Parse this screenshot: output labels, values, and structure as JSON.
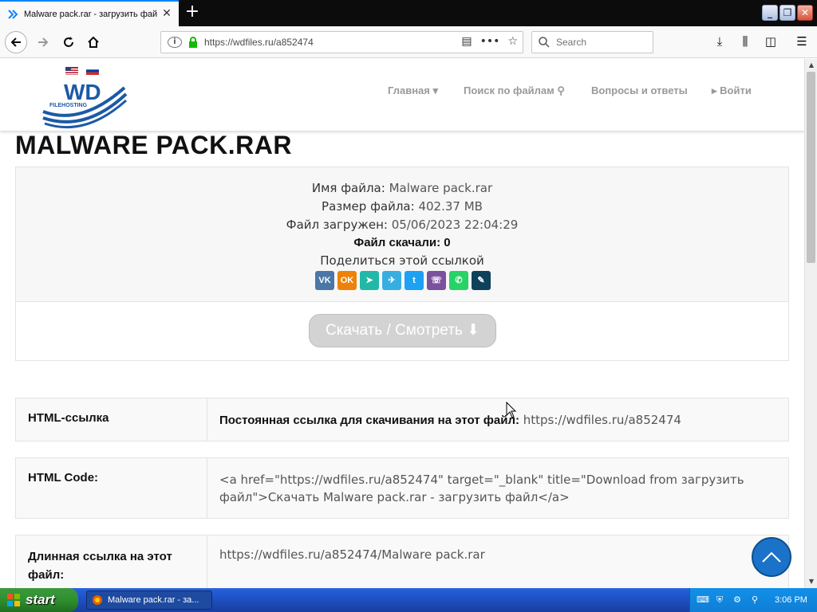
{
  "browser": {
    "tab_title": "Malware pack.rar - загрузить фай",
    "url": "https://wdfiles.ru/a852474",
    "search_placeholder": "Search"
  },
  "site": {
    "logo_text": "WD",
    "logo_sub": "FILEHOSTING",
    "nav": {
      "home": "Главная",
      "search": "Поиск по файлам",
      "faq": "Вопросы и ответы",
      "login": "Войти"
    }
  },
  "page": {
    "title": "MALWARE PACK.RAR",
    "file_name_label": "Имя файла:",
    "file_name": "Malware pack.rar",
    "file_size_label": "Размер файла:",
    "file_size": "402.37 MB",
    "uploaded_label": "Файл загружен:",
    "uploaded": "05/06/2023 22:04:29",
    "downloads": "Файл скачали: 0",
    "share_text": "Поделиться этой ссылкой",
    "download_button": "Скачать / Смотреть"
  },
  "share_icons": [
    {
      "name": "vk-icon",
      "glyph": "VK",
      "color": "#4a76a8"
    },
    {
      "name": "odnoklassniki-icon",
      "glyph": "OK",
      "color": "#ee8208"
    },
    {
      "name": "send-icon",
      "glyph": "➤",
      "color": "#22b8a7"
    },
    {
      "name": "telegram-icon",
      "glyph": "✈",
      "color": "#37aee2"
    },
    {
      "name": "twitter-icon",
      "glyph": "t",
      "color": "#1da1f2"
    },
    {
      "name": "viber-icon",
      "glyph": "☏",
      "color": "#7b519d"
    },
    {
      "name": "whatsapp-icon",
      "glyph": "✆",
      "color": "#25d366"
    },
    {
      "name": "livejournal-icon",
      "glyph": "✎",
      "color": "#0d425a"
    }
  ],
  "links": {
    "html_label": "HTML-ссылка",
    "html_desc": "Постоянная ссылка для скачивания на этот файл:",
    "html_url": "https://wdfiles.ru/a852474",
    "code_label": "HTML Code:",
    "code_value": "<a href=\"https://wdfiles.ru/a852474\" target=\"_blank\" title=\"Download from загрузить файл\">Скачать Malware pack.rar - загрузить файл</a>",
    "long_label": "Длинная ссылка на этот файл:",
    "long_url": "https://wdfiles.ru/a852474/Malware pack.rar"
  },
  "taskbar": {
    "start": "start",
    "task": "Malware pack.rar - за...",
    "clock": "3:06 PM"
  }
}
